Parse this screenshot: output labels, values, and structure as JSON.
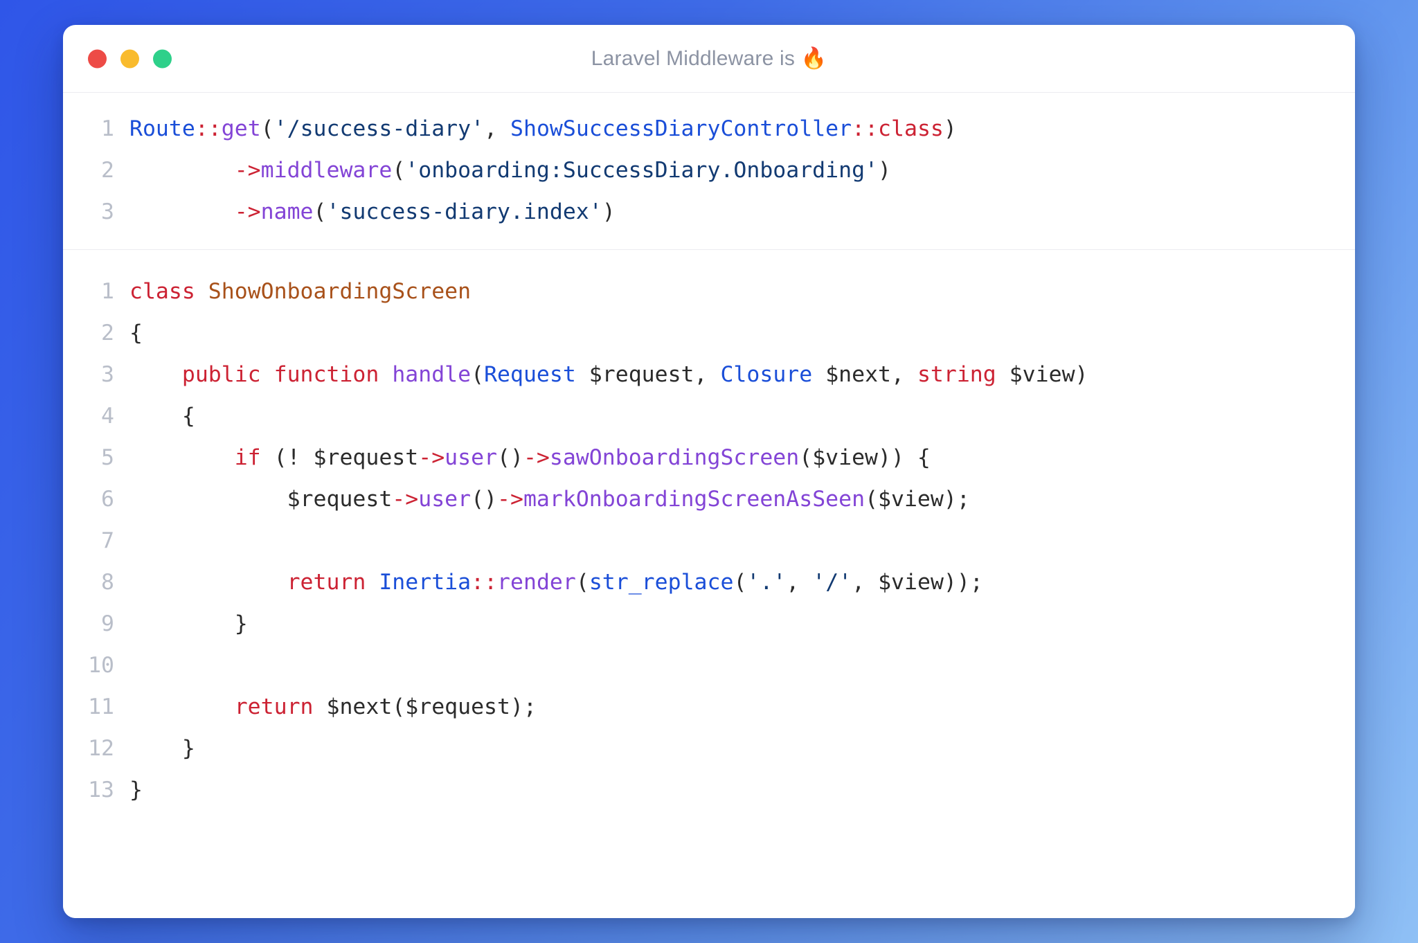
{
  "window": {
    "title_text": "Laravel Middleware is ",
    "title_emoji": "🔥",
    "traffic_lights": {
      "close": "close-button",
      "minimize": "minimize-button",
      "maximize": "maximize-button"
    }
  },
  "colors": {
    "background_gradient_start": "#2f56e8",
    "background_gradient_end": "#8fc0f5",
    "window_background": "#ffffff",
    "title_text": "#8c93a3",
    "line_number": "#b9bec9",
    "traffic_close": "#ed4b46",
    "traffic_minimize": "#f9bb2d",
    "traffic_maximize": "#2ed08a",
    "token_keyword": "#cc2233",
    "token_class": "#1a4ed8",
    "token_method": "#8344d6",
    "token_string": "#123a72",
    "token_classname": "#a8511a",
    "token_plain": "#2b2b2b"
  },
  "code_blocks": [
    {
      "name": "routes-block",
      "language": "php",
      "lines": [
        {
          "number": "1",
          "plain": "Route::get('/success-diary', ShowSuccessDiaryController::class)",
          "tokens": [
            {
              "t": "Route",
              "c": "t-class"
            },
            {
              "t": "::",
              "c": "t-op"
            },
            {
              "t": "get",
              "c": "t-method"
            },
            {
              "t": "(",
              "c": "t-punc"
            },
            {
              "t": "'/success-diary'",
              "c": "t-string"
            },
            {
              "t": ", ",
              "c": "t-punc"
            },
            {
              "t": "ShowSuccessDiaryController",
              "c": "t-class"
            },
            {
              "t": "::",
              "c": "t-op"
            },
            {
              "t": "class",
              "c": "t-kw"
            },
            {
              "t": ")",
              "c": "t-punc"
            }
          ]
        },
        {
          "number": "2",
          "plain": "        ->middleware('onboarding:SuccessDiary.Onboarding')",
          "tokens": [
            {
              "t": "        ",
              "c": "t-plain"
            },
            {
              "t": "->",
              "c": "t-op"
            },
            {
              "t": "middleware",
              "c": "t-method"
            },
            {
              "t": "(",
              "c": "t-punc"
            },
            {
              "t": "'onboarding:SuccessDiary.Onboarding'",
              "c": "t-string"
            },
            {
              "t": ")",
              "c": "t-punc"
            }
          ]
        },
        {
          "number": "3",
          "plain": "        ->name('success-diary.index')",
          "tokens": [
            {
              "t": "        ",
              "c": "t-plain"
            },
            {
              "t": "->",
              "c": "t-op"
            },
            {
              "t": "name",
              "c": "t-method"
            },
            {
              "t": "(",
              "c": "t-punc"
            },
            {
              "t": "'success-diary.index'",
              "c": "t-string"
            },
            {
              "t": ")",
              "c": "t-punc"
            }
          ]
        }
      ]
    },
    {
      "name": "middleware-class-block",
      "language": "php",
      "lines": [
        {
          "number": "1",
          "plain": "class ShowOnboardingScreen",
          "tokens": [
            {
              "t": "class",
              "c": "t-kw"
            },
            {
              "t": " ",
              "c": "t-plain"
            },
            {
              "t": "ShowOnboardingScreen",
              "c": "t-cname"
            }
          ]
        },
        {
          "number": "2",
          "plain": "{",
          "tokens": [
            {
              "t": "{",
              "c": "t-punc"
            }
          ]
        },
        {
          "number": "3",
          "plain": "    public function handle(Request $request, Closure $next, string $view)",
          "tokens": [
            {
              "t": "    ",
              "c": "t-plain"
            },
            {
              "t": "public function",
              "c": "t-kw"
            },
            {
              "t": " ",
              "c": "t-plain"
            },
            {
              "t": "handle",
              "c": "t-method"
            },
            {
              "t": "(",
              "c": "t-punc"
            },
            {
              "t": "Request",
              "c": "t-type"
            },
            {
              "t": " $request, ",
              "c": "t-plain"
            },
            {
              "t": "Closure",
              "c": "t-type"
            },
            {
              "t": " $next, ",
              "c": "t-plain"
            },
            {
              "t": "string",
              "c": "t-kw"
            },
            {
              "t": " $view)",
              "c": "t-plain"
            }
          ]
        },
        {
          "number": "4",
          "plain": "    {",
          "tokens": [
            {
              "t": "    {",
              "c": "t-punc"
            }
          ]
        },
        {
          "number": "5",
          "plain": "        if (! $request->user()->sawOnboardingScreen($view)) {",
          "tokens": [
            {
              "t": "        ",
              "c": "t-plain"
            },
            {
              "t": "if",
              "c": "t-kw"
            },
            {
              "t": " (! $request",
              "c": "t-plain"
            },
            {
              "t": "->",
              "c": "t-op"
            },
            {
              "t": "user",
              "c": "t-method"
            },
            {
              "t": "()",
              "c": "t-punc"
            },
            {
              "t": "->",
              "c": "t-op"
            },
            {
              "t": "sawOnboardingScreen",
              "c": "t-method"
            },
            {
              "t": "($view)) {",
              "c": "t-plain"
            }
          ]
        },
        {
          "number": "6",
          "plain": "            $request->user()->markOnboardingScreenAsSeen($view);",
          "tokens": [
            {
              "t": "            $request",
              "c": "t-plain"
            },
            {
              "t": "->",
              "c": "t-op"
            },
            {
              "t": "user",
              "c": "t-method"
            },
            {
              "t": "()",
              "c": "t-punc"
            },
            {
              "t": "->",
              "c": "t-op"
            },
            {
              "t": "markOnboardingScreenAsSeen",
              "c": "t-method"
            },
            {
              "t": "($view);",
              "c": "t-plain"
            }
          ]
        },
        {
          "number": "7",
          "plain": "",
          "tokens": []
        },
        {
          "number": "8",
          "plain": "            return Inertia::render(str_replace('.', '/', $view));",
          "tokens": [
            {
              "t": "            ",
              "c": "t-plain"
            },
            {
              "t": "return",
              "c": "t-kw"
            },
            {
              "t": " ",
              "c": "t-plain"
            },
            {
              "t": "Inertia",
              "c": "t-type"
            },
            {
              "t": "::",
              "c": "t-op"
            },
            {
              "t": "render",
              "c": "t-method"
            },
            {
              "t": "(",
              "c": "t-punc"
            },
            {
              "t": "str_replace",
              "c": "t-type"
            },
            {
              "t": "(",
              "c": "t-punc"
            },
            {
              "t": "'.'",
              "c": "t-string"
            },
            {
              "t": ", ",
              "c": "t-punc"
            },
            {
              "t": "'/'",
              "c": "t-string"
            },
            {
              "t": ", $view));",
              "c": "t-plain"
            }
          ]
        },
        {
          "number": "9",
          "plain": "        }",
          "tokens": [
            {
              "t": "        }",
              "c": "t-punc"
            }
          ]
        },
        {
          "number": "10",
          "plain": "",
          "tokens": []
        },
        {
          "number": "11",
          "plain": "        return $next($request);",
          "tokens": [
            {
              "t": "        ",
              "c": "t-plain"
            },
            {
              "t": "return",
              "c": "t-kw"
            },
            {
              "t": " $next($request);",
              "c": "t-plain"
            }
          ]
        },
        {
          "number": "12",
          "plain": "    }",
          "tokens": [
            {
              "t": "    }",
              "c": "t-punc"
            }
          ]
        },
        {
          "number": "13",
          "plain": "}",
          "tokens": [
            {
              "t": "}",
              "c": "t-punc"
            }
          ]
        }
      ]
    }
  ]
}
